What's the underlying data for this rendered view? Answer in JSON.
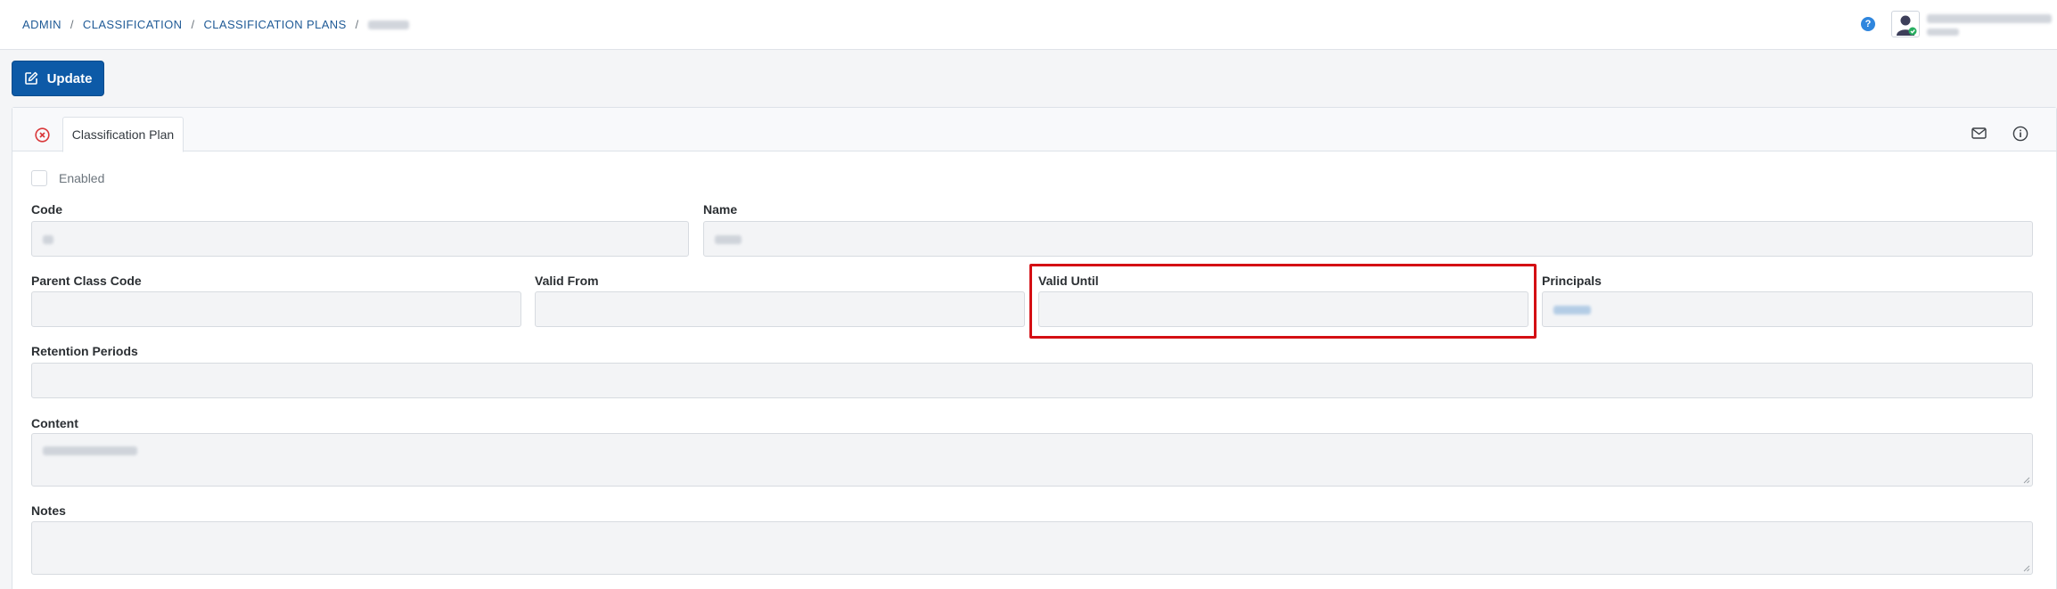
{
  "breadcrumb": {
    "items": [
      "ADMIN",
      "CLASSIFICATION",
      "CLASSIFICATION PLANS"
    ],
    "separator": "/"
  },
  "header": {
    "help_icon": "question-circle-icon",
    "help_glyph": "?",
    "avatar_icon": "user-avatar-icon"
  },
  "toolbar": {
    "update_label": "Update",
    "update_icon": "edit-icon"
  },
  "tabs": {
    "close_icon": "close-circle-icon",
    "active_label": "Classification Plan",
    "right_icons": [
      "mail-icon",
      "info-icon"
    ]
  },
  "form": {
    "enabled_label": "Enabled",
    "enabled_checked": false,
    "code_label": "Code",
    "name_label": "Name",
    "parent_label": "Parent Class Code",
    "valid_from_label": "Valid From",
    "valid_until_label": "Valid Until",
    "principals_label": "Principals",
    "retention_label": "Retention Periods",
    "content_label": "Content",
    "notes_label": "Notes"
  },
  "colors": {
    "primary": "#0d5aa7",
    "link": "#1f5a96",
    "highlight": "#d40f14",
    "close_icon": "#d9383a"
  }
}
